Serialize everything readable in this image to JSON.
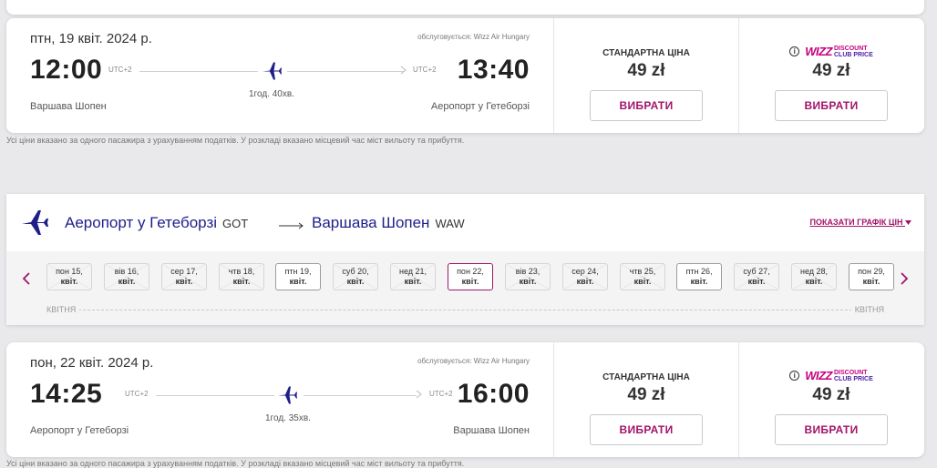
{
  "flight1": {
    "date": "птн, 19 квіт. 2024 р.",
    "operated_by": "обслуговується: Wizz Air Hungary",
    "dep_time": "12:00",
    "dep_utc": "UTC+2",
    "arr_time": "13:40",
    "arr_utc": "UTC+2",
    "duration": "1год. 40хв.",
    "dep_airport": "Варшава Шопен",
    "arr_airport": "Аеропорт у Гетеборзі",
    "standard_label": "СТАНДАРТНА ЦІНА",
    "standard_price": "49 zł",
    "club_price": "49 zł",
    "select_label": "ВИБРАТИ"
  },
  "club_logo": {
    "wizz": "WIZZ",
    "line1": "DISCOUNT",
    "line2": "CLUB PRICE",
    "info": "i"
  },
  "note": "Усі ціни вказано за одного пасажира з урахуванням податків. У розкладі вказано місцевий час міст вильоту та прибуття.",
  "route": {
    "from_name": "Аеропорт у Гетеборзі",
    "from_code": "GOT",
    "to_name": "Варшава Шопен",
    "to_code": "WAW",
    "show_chart": "ПОКАЗАТИ ГРАФІК ЦІН",
    "month_left": "КВІТНЯ",
    "month_right": "КВІТНЯ",
    "days": [
      {
        "label": "пон 15,",
        "sub": "квіт.",
        "state": "unavailable"
      },
      {
        "label": "вів 16,",
        "sub": "квіт.",
        "state": "unavailable"
      },
      {
        "label": "сер 17,",
        "sub": "квіт.",
        "state": "unavailable"
      },
      {
        "label": "чтв 18,",
        "sub": "квіт.",
        "state": "unavailable"
      },
      {
        "label": "птн 19,",
        "sub": "квіт.",
        "state": "available"
      },
      {
        "label": "суб 20,",
        "sub": "квіт.",
        "state": "unavailable"
      },
      {
        "label": "нед 21,",
        "sub": "квіт.",
        "state": "unavailable"
      },
      {
        "label": "пон 22,",
        "sub": "квіт.",
        "state": "selected"
      },
      {
        "label": "вів 23,",
        "sub": "квіт.",
        "state": "unavailable"
      },
      {
        "label": "сер 24,",
        "sub": "квіт.",
        "state": "unavailable"
      },
      {
        "label": "чтв 25,",
        "sub": "квіт.",
        "state": "unavailable"
      },
      {
        "label": "птн 26,",
        "sub": "квіт.",
        "state": "available"
      },
      {
        "label": "суб 27,",
        "sub": "квіт.",
        "state": "unavailable"
      },
      {
        "label": "нед 28,",
        "sub": "квіт.",
        "state": "unavailable"
      },
      {
        "label": "пон 29,",
        "sub": "квіт.",
        "state": "available"
      }
    ]
  },
  "flight2": {
    "date": "пон, 22 квіт. 2024 р.",
    "operated_by": "обслуговується: Wizz Air Hungary",
    "dep_time": "14:25",
    "dep_utc": "UTC+2",
    "arr_time": "16:00",
    "arr_utc": "UTC+2",
    "duration": "1год. 35хв.",
    "dep_airport": "Аеропорт у Гетеборзі",
    "arr_airport": "Варшава Шопен",
    "standard_label": "СТАНДАРТНА ЦІНА",
    "standard_price": "49 zł",
    "club_price": "49 zł",
    "select_label": "ВИБРАТИ"
  },
  "colors": {
    "brand_magenta": "#a21469",
    "brand_navy": "#1e1e8a",
    "wizz_pink": "#c6007e"
  },
  "icons": [
    "airplane-icon",
    "arrow-right-icon",
    "info-icon",
    "chevron-left-icon",
    "chevron-right-icon",
    "caret-down-icon"
  ]
}
